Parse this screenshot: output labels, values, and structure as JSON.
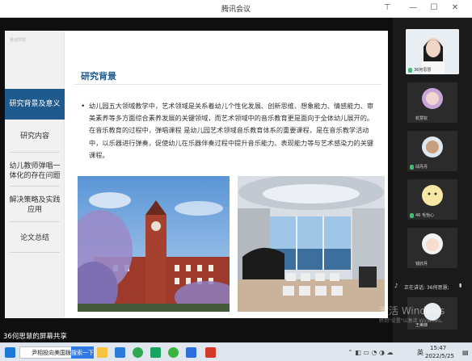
{
  "window": {
    "title": "腾讯会议"
  },
  "slide": {
    "logo_text": "晋城学院",
    "nav": [
      {
        "label": "研究背景及意义",
        "active": true
      },
      {
        "label": "研究内容",
        "active": false
      },
      {
        "label": "幼儿教师弹唱一体化的存在问题",
        "active": false
      },
      {
        "label": "解决策略及实践应用",
        "active": false
      },
      {
        "label": "论文总结",
        "active": false
      }
    ],
    "heading": "研究背景",
    "bullet": "•",
    "paragraph": "幼儿园五大领域教学中，艺术领域是关系着幼儿个性化发展、创新思维、想象能力、情感能力、审美素养等多方面综合素养发展的关键领域，而艺术领域中的音乐教育更是面向于全体幼儿展开的。在音乐教育的过程中，弹唱课程 是幼儿园艺术领域音乐教育体系的重要课程，是在音乐教学活动中，以乐器进行弹奏，促使幼儿在乐器伴奏过程中提升音乐能力、表现能力等与艺术感染力的关键课程。"
  },
  "participants": [
    {
      "name": "36何思慧",
      "mic": true
    },
    {
      "name": "杭慧钦",
      "mic": false
    },
    {
      "name": "邱丹丹",
      "mic": true
    },
    {
      "name": "46 毛怡心",
      "mic": true
    },
    {
      "name": "钱欣月",
      "mic": false
    },
    {
      "name": "王美娣",
      "mic": false
    }
  ],
  "speaking": {
    "label": "正在讲话: 36何思慧;"
  },
  "share_banner": {
    "text": "36何思慧的屏幕共享"
  },
  "watermark": {
    "line1": "激活 Windows",
    "line2": "转到\"设置\"以激活 Windows。"
  },
  "taskbar": {
    "start_icon": "windows-icon",
    "search_text": "尹相投向美国拨...",
    "search_button": "搜索一下",
    "lang": "英",
    "time": "15:47",
    "date": "2022/5/25",
    "apps": [
      "file-explorer-icon",
      "shield-icon",
      "browser-icon",
      "play-icon",
      "wechat-icon",
      "meeting-icon",
      "red-app-icon"
    ]
  },
  "colors": {
    "accent": "#1f5a8e",
    "mic_on": "#38c172"
  }
}
